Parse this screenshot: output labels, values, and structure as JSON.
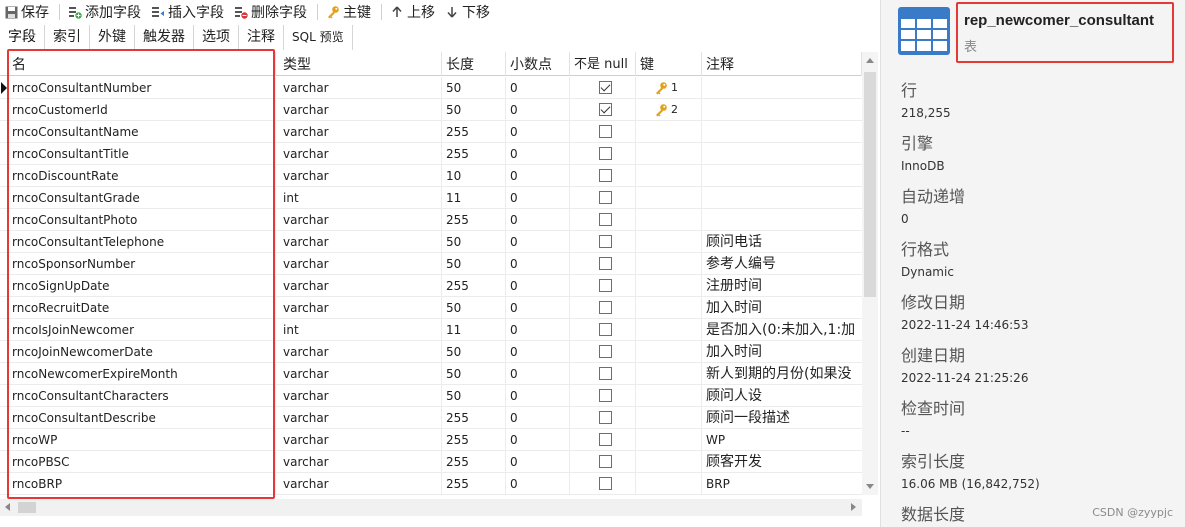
{
  "toolbar": {
    "save": "保存",
    "add_field": "添加字段",
    "insert_field": "插入字段",
    "delete_field": "删除字段",
    "primary_key": "主键",
    "move_up": "上移",
    "move_down": "下移"
  },
  "tabs": [
    "字段",
    "索引",
    "外键",
    "触发器",
    "选项",
    "注释",
    "SQL 预览"
  ],
  "columns": {
    "name": "名",
    "type": "类型",
    "length": "长度",
    "decimals": "小数点",
    "not_null": "不是 null",
    "key": "键",
    "comment": "注释"
  },
  "rows": [
    {
      "name": "rncoConsultantNumber",
      "type": "varchar",
      "length": "50",
      "decimals": "0",
      "not_null": true,
      "key": "1",
      "comment": ""
    },
    {
      "name": "rncoCustomerId",
      "type": "varchar",
      "length": "50",
      "decimals": "0",
      "not_null": true,
      "key": "2",
      "comment": ""
    },
    {
      "name": "rncoConsultantName",
      "type": "varchar",
      "length": "255",
      "decimals": "0",
      "not_null": false,
      "key": "",
      "comment": ""
    },
    {
      "name": "rncoConsultantTitle",
      "type": "varchar",
      "length": "255",
      "decimals": "0",
      "not_null": false,
      "key": "",
      "comment": ""
    },
    {
      "name": "rncoDiscountRate",
      "type": "varchar",
      "length": "10",
      "decimals": "0",
      "not_null": false,
      "key": "",
      "comment": ""
    },
    {
      "name": "rncoConsultantGrade",
      "type": "int",
      "length": "11",
      "decimals": "0",
      "not_null": false,
      "key": "",
      "comment": ""
    },
    {
      "name": "rncoConsultantPhoto",
      "type": "varchar",
      "length": "255",
      "decimals": "0",
      "not_null": false,
      "key": "",
      "comment": ""
    },
    {
      "name": "rncoConsultantTelephone",
      "type": "varchar",
      "length": "50",
      "decimals": "0",
      "not_null": false,
      "key": "",
      "comment": "顾问电话"
    },
    {
      "name": "rncoSponsorNumber",
      "type": "varchar",
      "length": "50",
      "decimals": "0",
      "not_null": false,
      "key": "",
      "comment": "参考人编号"
    },
    {
      "name": "rncoSignUpDate",
      "type": "varchar",
      "length": "255",
      "decimals": "0",
      "not_null": false,
      "key": "",
      "comment": "注册时间"
    },
    {
      "name": "rncoRecruitDate",
      "type": "varchar",
      "length": "50",
      "decimals": "0",
      "not_null": false,
      "key": "",
      "comment": "加入时间"
    },
    {
      "name": "rncoIsJoinNewcomer",
      "type": "int",
      "length": "11",
      "decimals": "0",
      "not_null": false,
      "key": "",
      "comment": "是否加入(0:未加入,1:加"
    },
    {
      "name": "rncoJoinNewcomerDate",
      "type": "varchar",
      "length": "50",
      "decimals": "0",
      "not_null": false,
      "key": "",
      "comment": "加入时间"
    },
    {
      "name": "rncoNewcomerExpireMonth",
      "type": "varchar",
      "length": "50",
      "decimals": "0",
      "not_null": false,
      "key": "",
      "comment": "新人到期的月份(如果没"
    },
    {
      "name": "rncoConsultantCharacters",
      "type": "varchar",
      "length": "50",
      "decimals": "0",
      "not_null": false,
      "key": "",
      "comment": "顾问人设"
    },
    {
      "name": "rncoConsultantDescribe",
      "type": "varchar",
      "length": "255",
      "decimals": "0",
      "not_null": false,
      "key": "",
      "comment": "顾问一段描述"
    },
    {
      "name": "rncoWP",
      "type": "varchar",
      "length": "255",
      "decimals": "0",
      "not_null": false,
      "key": "",
      "comment": "WP"
    },
    {
      "name": "rncoPBSC",
      "type": "varchar",
      "length": "255",
      "decimals": "0",
      "not_null": false,
      "key": "",
      "comment": "顾客开发"
    },
    {
      "name": "rncoBRP",
      "type": "varchar",
      "length": "255",
      "decimals": "0",
      "not_null": false,
      "key": "",
      "comment": "BRP"
    }
  ],
  "panel": {
    "table_name": "rep_newcomer_consultant",
    "object_type": "表",
    "info": [
      {
        "label": "行",
        "value": "218,255"
      },
      {
        "label": "引擎",
        "value": "InnoDB"
      },
      {
        "label": "自动递增",
        "value": "0"
      },
      {
        "label": "行格式",
        "value": "Dynamic"
      },
      {
        "label": "修改日期",
        "value": "2022-11-24 14:46:53"
      },
      {
        "label": "创建日期",
        "value": "2022-11-24 21:25:26"
      },
      {
        "label": "检查时间",
        "value": "--"
      },
      {
        "label": "索引长度",
        "value": "16.06 MB (16,842,752)"
      },
      {
        "label": "数据长度",
        "value": ""
      }
    ]
  },
  "watermark": "CSDN @zyypjc",
  "colors": {
    "highlight": "#e53935",
    "key_icon": "#e0a21b",
    "panel_bg": "#f4f4f4"
  }
}
